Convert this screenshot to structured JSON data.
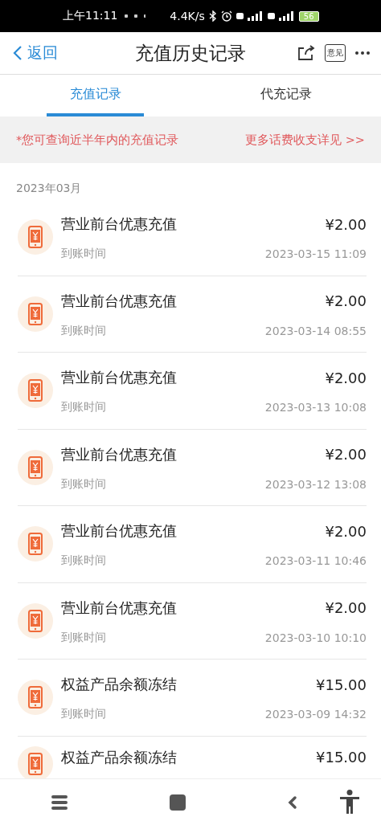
{
  "status_bar": {
    "time": "上午11:11",
    "speed": "4.4K/s",
    "battery": "56"
  },
  "header": {
    "back": "返回",
    "title": "充值历史记录",
    "feedback": "意见"
  },
  "tabs": [
    {
      "label": "充值记录",
      "selected": true
    },
    {
      "label": "代充记录",
      "selected": false
    }
  ],
  "notice": {
    "text": "*您可查询近半年内的充值记录",
    "link": "更多话费收支详见 >>"
  },
  "month": "2023年03月",
  "records": [
    {
      "title": "营业前台优惠充值",
      "amount": "¥2.00",
      "label": "到账时间",
      "time": "2023-03-15 11:09"
    },
    {
      "title": "营业前台优惠充值",
      "amount": "¥2.00",
      "label": "到账时间",
      "time": "2023-03-14 08:55"
    },
    {
      "title": "营业前台优惠充值",
      "amount": "¥2.00",
      "label": "到账时间",
      "time": "2023-03-13 10:08"
    },
    {
      "title": "营业前台优惠充值",
      "amount": "¥2.00",
      "label": "到账时间",
      "time": "2023-03-12 13:08"
    },
    {
      "title": "营业前台优惠充值",
      "amount": "¥2.00",
      "label": "到账时间",
      "time": "2023-03-11 10:46"
    },
    {
      "title": "营业前台优惠充值",
      "amount": "¥2.00",
      "label": "到账时间",
      "time": "2023-03-10 10:10"
    },
    {
      "title": "权益产品余额冻结",
      "amount": "¥15.00",
      "label": "到账时间",
      "time": "2023-03-09 14:32"
    },
    {
      "title": "权益产品余额冻结",
      "amount": "¥15.00"
    }
  ]
}
